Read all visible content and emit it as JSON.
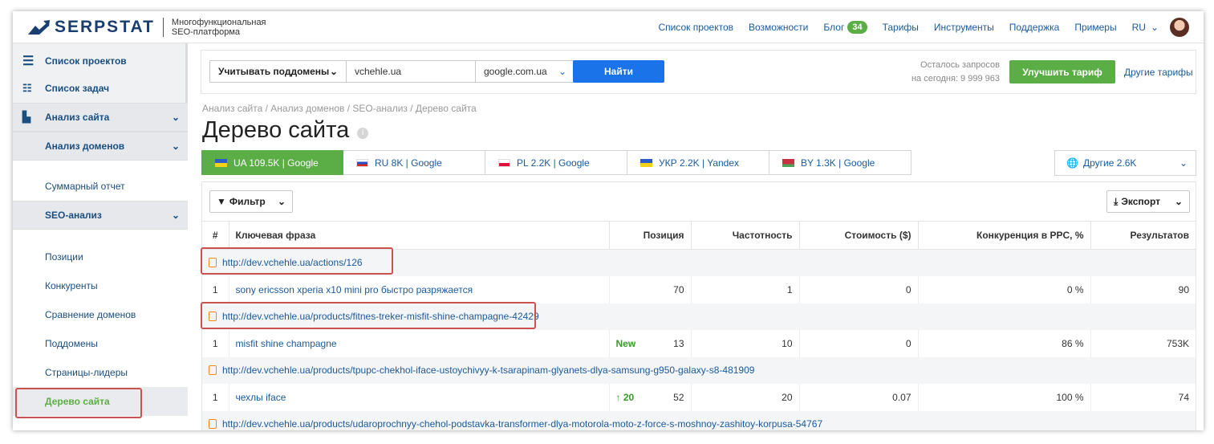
{
  "header": {
    "logo_text": "SERPSTAT",
    "logo_sub_1": "Многофункциональная",
    "logo_sub_2": "SEO-платформа",
    "nav": [
      "Список проектов",
      "Возможности",
      "Блог",
      "Тарифы",
      "Инструменты",
      "Поддержка",
      "Примеры"
    ],
    "blog_badge": "34",
    "lang": "RU"
  },
  "sidebar": {
    "projects": "Список проектов",
    "tasks": "Список задач",
    "site_analysis": "Анализ сайта",
    "domain_analysis": "Анализ доменов",
    "summary": "Суммарный отчет",
    "seo_analysis": "SEO-анализ",
    "positions": "Позиции",
    "competitors": "Конкуренты",
    "compare": "Сравнение доменов",
    "subdomains": "Поддомены",
    "top_pages": "Страницы-лидеры",
    "site_tree": "Дерево сайта"
  },
  "search": {
    "subdomains": "Учитывать поддомены",
    "domain": "vchehle.ua",
    "engine": "google.com.ua",
    "find": "Найти",
    "remain_1": "Осталось запросов",
    "remain_2": "на сегодня: 9 999 963",
    "upgrade": "Улучшить тариф",
    "other_plans": "Другие тарифы"
  },
  "breadcrumbs": "Анализ сайта / Анализ доменов / SEO-анализ / Дерево сайта",
  "title": "Дерево сайта",
  "tabs": [
    "UA 109.5K | Google",
    "RU 8K | Google",
    "PL 2.2K | Google",
    "УКР 2.2K | Yandex",
    "BY 1.3K | Google"
  ],
  "tab_other": "Другие 2.6K",
  "filter": "Фильтр",
  "export": "Экспорт",
  "table": {
    "headers": [
      "#",
      "Ключевая фраза",
      "Позиция",
      "Частотность",
      "Стоимость ($)",
      "Конкуренция в PPC, %",
      "Результатов"
    ],
    "url1": "http://dev.vchehle.ua/actions/126",
    "row1": [
      "1",
      "sony ericsson xperia x10 mini pro быстро разряжается",
      "70",
      "1",
      "0",
      "0 %",
      "90"
    ],
    "url2": "http://dev.vchehle.ua/products/fitnes-treker-misfit-shine-champagne-42429",
    "row2": [
      "1",
      "misfit shine champagne",
      "13",
      "10",
      "0",
      "86 %",
      "753K"
    ],
    "row2_tag": "New",
    "url3": "http://dev.vchehle.ua/products/tpupc-chekhol-iface-ustoychivyy-k-tsarapinam-glyanets-dlya-samsung-g950-galaxy-s8-481909",
    "row3": [
      "1",
      "чехлы iface",
      "52",
      "20",
      "0.07",
      "100 %",
      "74"
    ],
    "row3_tag": "20",
    "url4": "http://dev.vchehle.ua/products/udaroprochnyy-chehol-podstavka-transformer-dlya-motorola-moto-z-force-s-moshnoy-zashitoy-korpusa-54767"
  }
}
